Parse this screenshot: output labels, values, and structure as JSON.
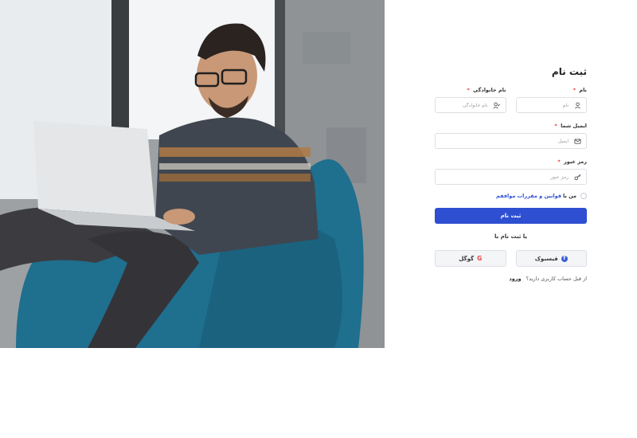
{
  "form": {
    "title": "ثبت نام",
    "first_name": {
      "label": "نام",
      "placeholder": "نام",
      "icon": "user-icon"
    },
    "last_name": {
      "label": "نام خانوادگی",
      "placeholder": "نام خانوادگی",
      "icon": "user-check-icon"
    },
    "email": {
      "label": "ایمیل شما",
      "placeholder": "ایمیل",
      "icon": "mail-icon"
    },
    "password": {
      "label": "رمز عبور",
      "placeholder": "رمز عبور",
      "icon": "key-icon"
    },
    "required_mark": "*",
    "terms": {
      "prefix": "من با",
      "link": "قوانین و مقررات موافقم"
    },
    "submit_label": "ثبت نام",
    "or_text": "یا ثبت نام با",
    "social": {
      "facebook_label": "فیسبوک",
      "google_label": "گوگل",
      "google_glyph": "G",
      "facebook_glyph": "f"
    },
    "login_prompt": "از قبل حساب کاربری دارید؟",
    "login_link": "ورود"
  },
  "colors": {
    "primary": "#2e4fd1",
    "link": "#2c4fd6",
    "required": "#e03b3b"
  }
}
